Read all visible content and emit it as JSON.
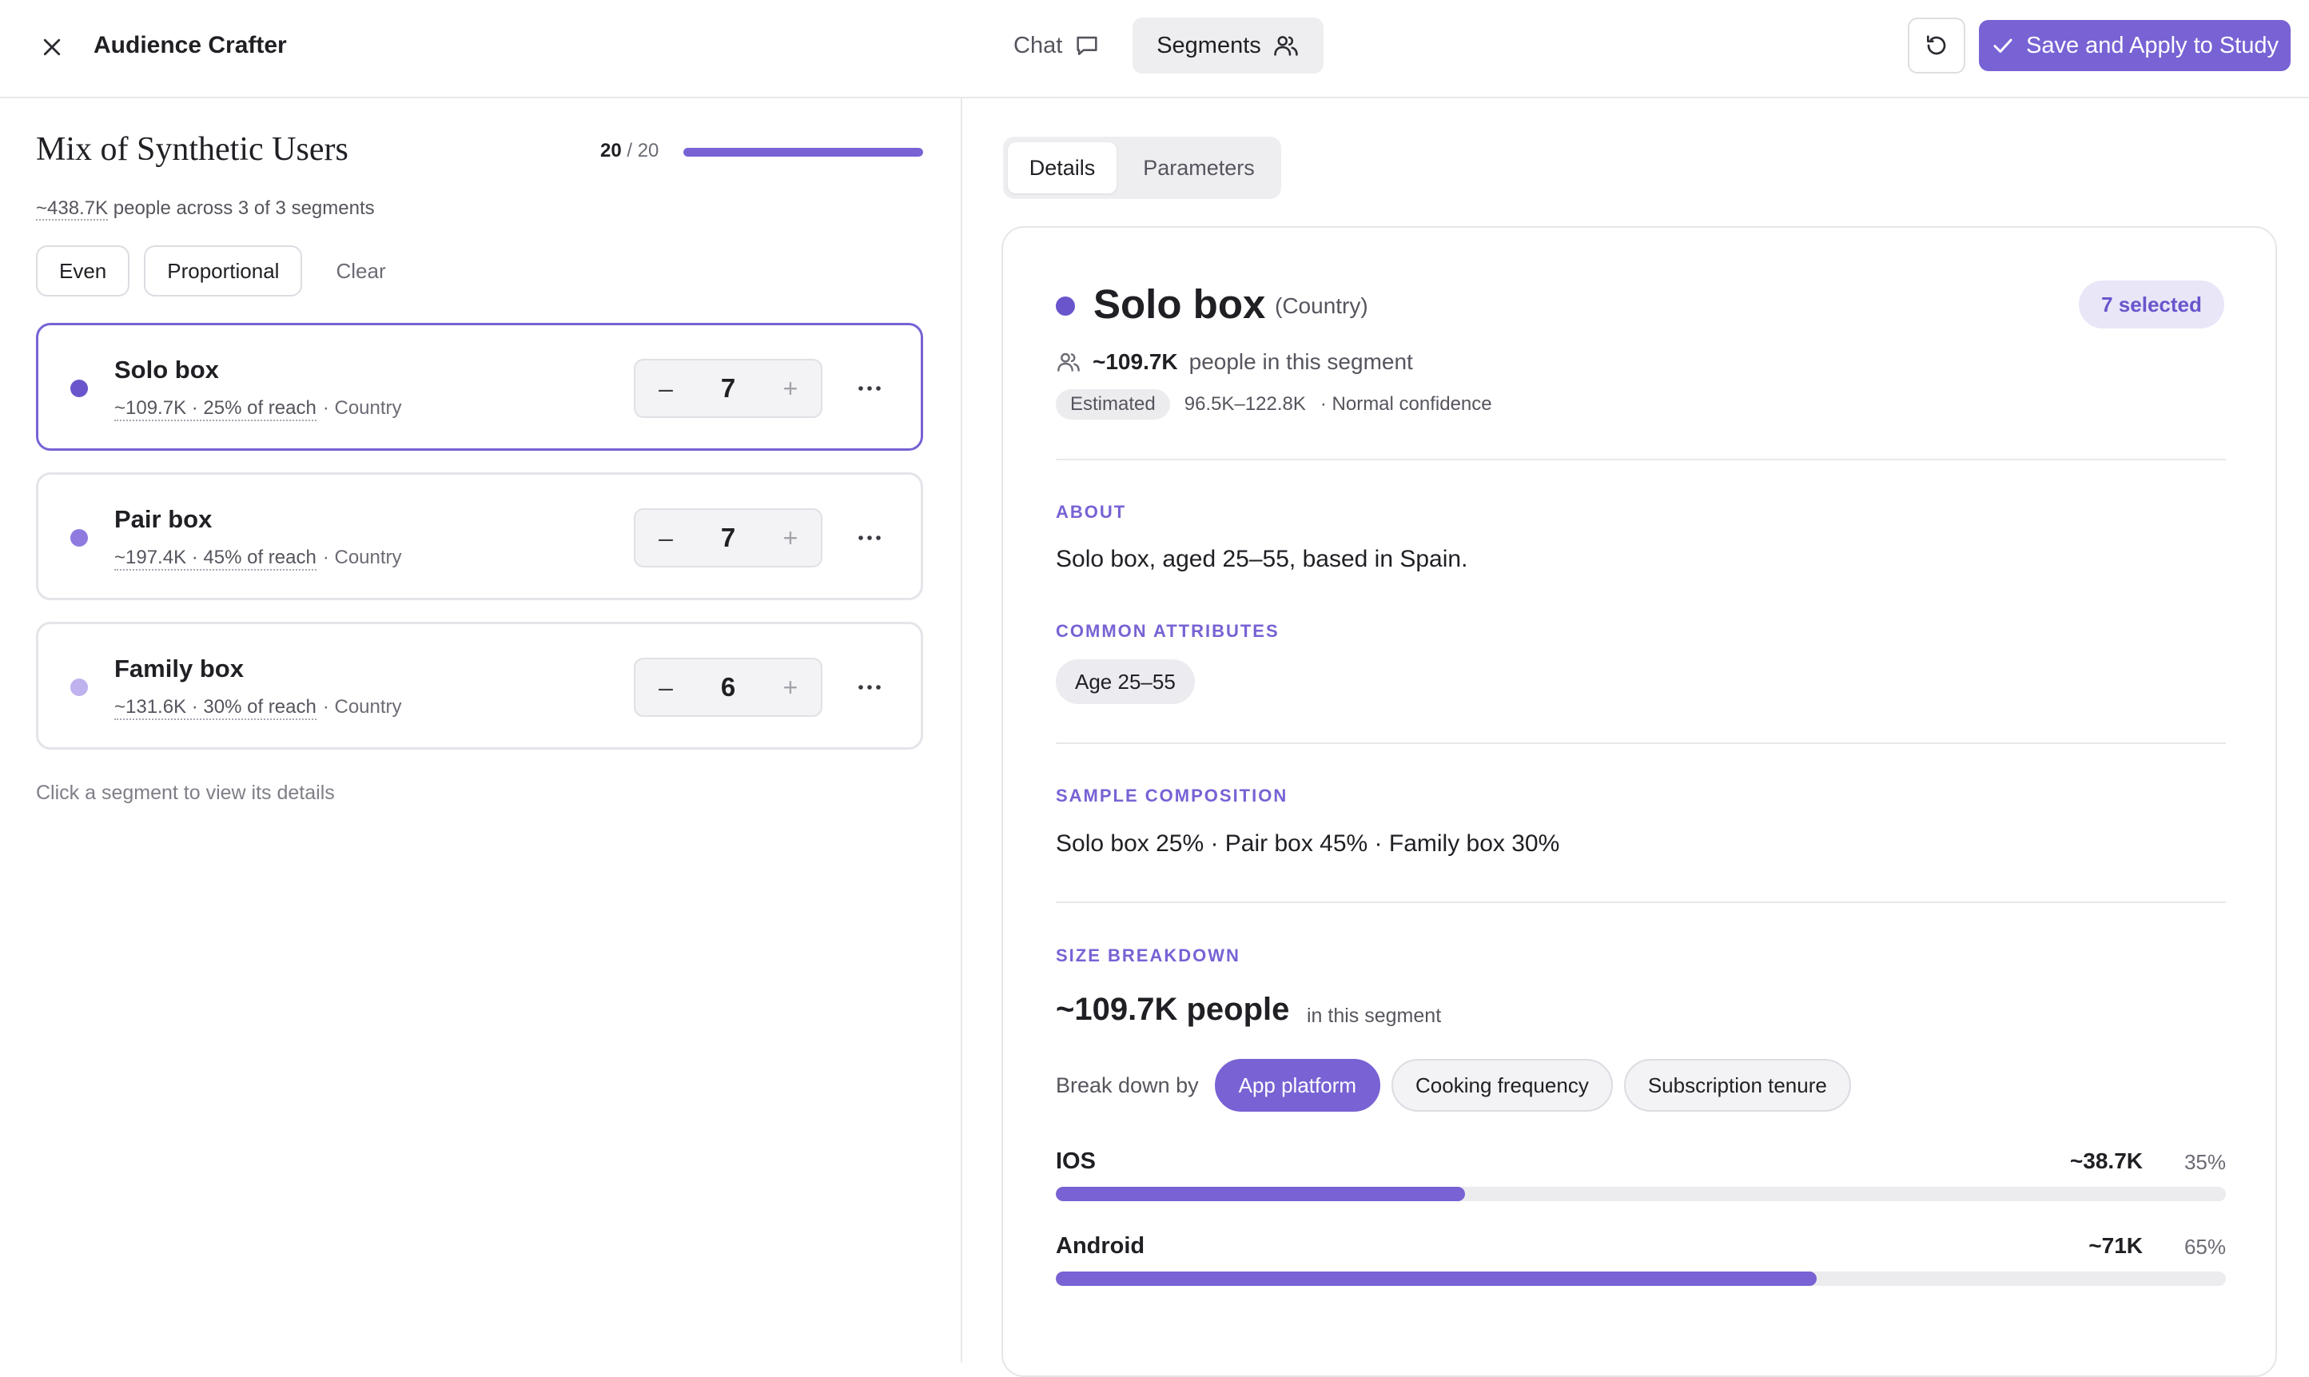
{
  "header": {
    "title": "Audience Crafter",
    "modes": {
      "chat": "Chat",
      "segments": "Segments"
    },
    "save_label": "Save and Apply to Study"
  },
  "mix": {
    "title": "Mix of Synthetic Users",
    "count_current": "20",
    "count_total": "/ 20",
    "count_fraction": 1.0,
    "reach_total": "~438.7K",
    "reach_rest": "people across 3 of 3 segments",
    "allocation": {
      "even": "Even",
      "proportional": "Proportional",
      "clear": "Clear"
    },
    "segments": [
      {
        "name": "Solo box",
        "reach": "~109.7K · 25% of reach",
        "type": "· Country",
        "count": "7",
        "color": "#6a55cc",
        "selected": true
      },
      {
        "name": "Pair box",
        "reach": "~197.4K · 45% of reach",
        "type": "· Country",
        "count": "7",
        "color": "#8f7ae0",
        "selected": false
      },
      {
        "name": "Family box",
        "reach": "~131.6K · 30% of reach",
        "type": "· Country",
        "count": "6",
        "color": "#bfb2ef",
        "selected": false
      }
    ],
    "hint": "Click a segment to view its details"
  },
  "detail": {
    "tabs": {
      "details": "Details",
      "parameters": "Parameters"
    },
    "name": "Solo box",
    "type": "(Country)",
    "selected_badge": "7 selected",
    "people_count": "~109.7K",
    "people_suffix": "people in this segment",
    "estimated_badge": "Estimated",
    "range": "96.5K–122.8K",
    "confidence": "· Normal confidence",
    "about_label": "ABOUT",
    "about_text": "Solo box, aged 25–55, based in Spain.",
    "attributes_label": "COMMON ATTRIBUTES",
    "attribute_chip": "Age 25–55",
    "composition_label": "SAMPLE COMPOSITION",
    "composition_text": "Solo box 25% · Pair box 45% · Family box 30%",
    "size_label": "SIZE BREAKDOWN",
    "size_number": "~109.7K people",
    "size_sub": "in this segment",
    "breakdown_label": "Break down by",
    "breakdown_options": [
      "App platform",
      "Cooking frequency",
      "Subscription tenure"
    ],
    "breakdown_active": "App platform",
    "bars": [
      {
        "name": "IOS",
        "count": "~38.7K",
        "pct": "35%",
        "fraction": 0.35
      },
      {
        "name": "Android",
        "count": "~71K",
        "pct": "65%",
        "fraction": 0.65
      }
    ]
  },
  "colors": {
    "accent": "#7862d4",
    "accent_dark": "#6a55cc"
  },
  "icons": {
    "close": "close-icon",
    "chat": "chat-bubble-icon",
    "segments": "users-icon",
    "reset": "reset-icon",
    "save": "check-icon",
    "more": "more-horizontal-icon",
    "people": "users-icon"
  }
}
